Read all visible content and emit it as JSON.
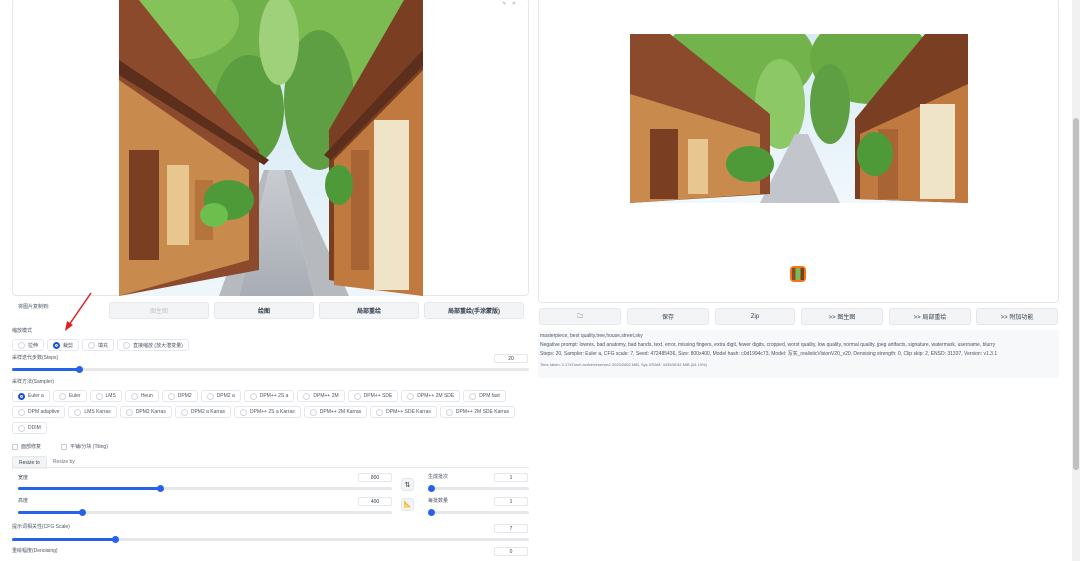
{
  "send_to": {
    "label": "将图片复制到:",
    "buttons": [
      "图生图",
      "绘图",
      "局部重绘",
      "局部重绘(手涂蒙版)"
    ]
  },
  "resize_mode": {
    "label": "缩放模式",
    "options": [
      "拉伸",
      "裁剪",
      "填充",
      "直接缩放 (放大潜变量)"
    ],
    "selected": 1
  },
  "steps": {
    "label": "采样迭代步数(Steps)",
    "value": "20",
    "fraction": 0.13
  },
  "sampler": {
    "label": "采样方法(Sampler)",
    "row1": [
      "Euler a",
      "Euler",
      "LMS",
      "Heun",
      "DPM2",
      "DPM2 a",
      "DPM++ 2S a",
      "DPM++ 2M",
      "DPM++ SDE",
      "DPM++ 2M SDE",
      "DPM fast"
    ],
    "row2": [
      "DPM adaptive",
      "LMS Karras",
      "DPM2 Karras",
      "DPM2 a Karras",
      "DPM++ 2S a Karras",
      "DPM++ 2M Karras",
      "DPM++ SDE Karras",
      "DPM++ 2M SDE Karras"
    ],
    "row3": [
      "DDIM"
    ],
    "selected": "Euler a"
  },
  "checks": {
    "restore_faces": "面部修复",
    "tiling": "平铺/分块 (Tiling)"
  },
  "resize_tabs": [
    "Resize to",
    "Resize by"
  ],
  "width": {
    "label": "宽度",
    "value": "800",
    "fraction": 0.38
  },
  "height": {
    "label": "高度",
    "value": "400",
    "fraction": 0.17
  },
  "batch_count": {
    "label": "生成批次",
    "value": "1",
    "fraction": 0.0
  },
  "batch_size": {
    "label": "每批数量",
    "value": "1",
    "fraction": 0.0
  },
  "swap_icon": "⇅",
  "ruler_icon": "📐",
  "cfg": {
    "label": "提示词相关性(CFG Scale)",
    "value": "7",
    "fraction": 0.2
  },
  "denoise": {
    "label": "重绘幅度(Denoising)",
    "value": "0",
    "fraction": 0.0
  },
  "right_buttons": [
    "🗀",
    "保存",
    "Zip",
    ">> 图生图",
    ">> 局部重绘",
    ">> 附加功能"
  ],
  "info": {
    "prompt": "masterpiece, best quality,tree,house,street,sky",
    "negative": "Negative prompt: lowres, bad anatomy, bad hands, text, error, missing fingers, extra digit, fewer digits, cropped, worst quality, low quality, normal quality, jpeg artifacts, signature, watermark, username, blurry",
    "params": "Steps: 20, Sampler: Euler a, CFG scale: 7, Seed: 472485436, Size: 800x400, Model hash: c0d1994c73, Model: 写实_realisticVisionV20_v20, Denoising strength: 0, Clip skip: 2, ENSD: 31337, Version: v1.3.1",
    "time": "Time taken: 2.17sTorch active/reserved: 2023/2862 MiB, Sys VRAM: 4439/8192 MiB (54.19%)"
  },
  "colors": {
    "accent": "#2563eb",
    "thumb_border": "#f97316",
    "arrow": "#e11d1d"
  }
}
